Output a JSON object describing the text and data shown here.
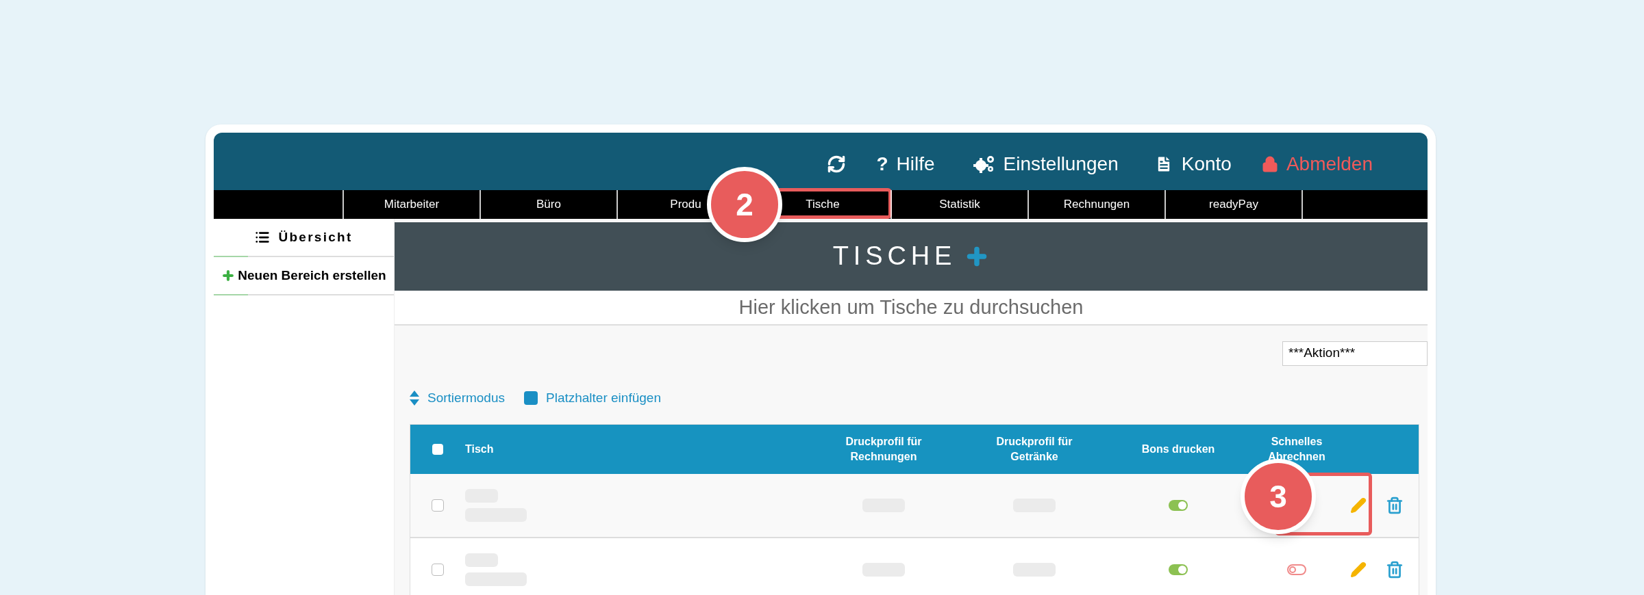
{
  "header": {
    "actions": [
      {
        "kind": "refresh"
      },
      {
        "kind": "help",
        "icon_text": "?",
        "label": "Hilfe"
      },
      {
        "kind": "settings",
        "label": "Einstellungen"
      },
      {
        "kind": "account",
        "label": "Konto"
      },
      {
        "kind": "logout",
        "label": "Abmelden"
      }
    ]
  },
  "nav": {
    "items": [
      {
        "label": "Mitarbeiter",
        "highlighted": false
      },
      {
        "label": "Büro",
        "highlighted": false
      },
      {
        "label": "Produ",
        "highlighted": false
      },
      {
        "label": "Tische",
        "highlighted": true,
        "callout": "2"
      },
      {
        "label": "Statistik",
        "highlighted": false
      },
      {
        "label": "Rechnungen",
        "highlighted": false
      },
      {
        "label": "readyPay",
        "highlighted": false
      }
    ]
  },
  "sidebar": {
    "items": [
      {
        "kind": "overview",
        "label": "Übersicht"
      },
      {
        "kind": "create",
        "label": "Neuen Bereich erstellen"
      }
    ]
  },
  "main": {
    "title": "TISCHE",
    "search": {
      "placeholder": "Hier klicken um Tische zu durchsuchen"
    },
    "action_select": {
      "value": "***Aktion***"
    },
    "tools": [
      {
        "kind": "sort",
        "label": "Sortiermodus"
      },
      {
        "kind": "placeholder",
        "label": "Platzhalter einfügen"
      }
    ],
    "table": {
      "select_all": {
        "checked": false
      },
      "columns": [
        "Tisch",
        "Druckprofil für Rechnungen",
        "Druckprofil für Getränke",
        "Bons drucken",
        "Schnelles Abrechnen"
      ],
      "rows": [
        {
          "checked": false,
          "bons_drucken": true,
          "edit_highlighted": true,
          "callout": "3"
        },
        {
          "checked": false,
          "bons_drucken": true,
          "schnelles_abrechnen": false,
          "edit_highlighted": false
        }
      ]
    }
  }
}
